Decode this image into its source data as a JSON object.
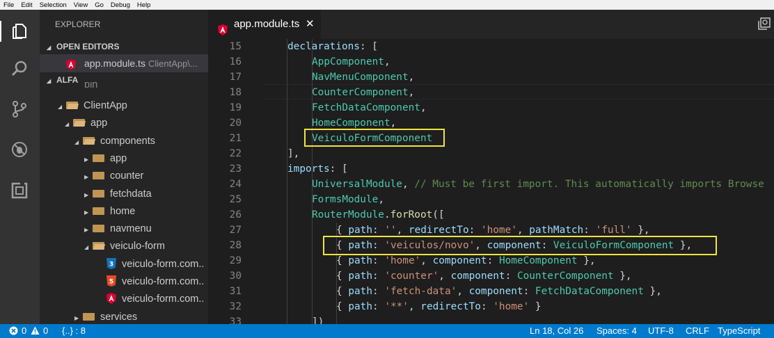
{
  "menubar": {
    "items": [
      "File",
      "Edit",
      "Selection",
      "View",
      "Go",
      "Debug",
      "Help"
    ]
  },
  "activity": {
    "icons": [
      "files-icon",
      "search-icon",
      "source-control-icon",
      "debug-icon",
      "extensions-icon"
    ]
  },
  "sidebar": {
    "title": "EXPLORER",
    "open_editors_label": "OPEN EDITORS",
    "open_editor": {
      "name": "app.module.ts",
      "path": "ClientApp\\..."
    },
    "project_label": "ALFA",
    "tree": [
      {
        "label": "bin"
      },
      {
        "label": "ClientApp"
      },
      {
        "label": "app"
      },
      {
        "label": "components"
      },
      {
        "label": "app"
      },
      {
        "label": "counter"
      },
      {
        "label": "fetchdata"
      },
      {
        "label": "home"
      },
      {
        "label": "navmenu"
      },
      {
        "label": "veiculo-form"
      },
      {
        "label": "veiculo-form.com..",
        "icon": "css-file-icon"
      },
      {
        "label": "veiculo-form.com..",
        "icon": "html-file-icon"
      },
      {
        "label": "veiculo-form.com..",
        "icon": "angular-file-icon"
      },
      {
        "label": "services"
      }
    ]
  },
  "tab": {
    "name": "app.module.ts",
    "close": "✕"
  },
  "editor": {
    "lines": [
      {
        "num": "15",
        "p1": "declarations",
        "p2": ": ["
      },
      {
        "num": "16",
        "p1": "AppComponent",
        "p2": ","
      },
      {
        "num": "17",
        "p1": "NavMenuComponent",
        "p2": ","
      },
      {
        "num": "18",
        "p1": "CounterComponent",
        "p2": ","
      },
      {
        "num": "19",
        "p1": "FetchDataComponent",
        "p2": ","
      },
      {
        "num": "20",
        "p1": "HomeComponent",
        "p2": ","
      },
      {
        "num": "21",
        "p1": "VeiculoFormComponent",
        "p2": ""
      },
      {
        "num": "22",
        "p1": "],",
        "p2": ""
      },
      {
        "num": "23",
        "p1": "imports",
        "p2": ": ["
      },
      {
        "num": "24",
        "p1": "UniversalModule",
        "p2": ", ",
        "p3": "// Must be first import. This automatically imports Browse"
      },
      {
        "num": "25",
        "p1": "FormsModule",
        "p2": ","
      },
      {
        "num": "26",
        "p1": "RouterModule",
        "p2": ".",
        "p3": "forRoot",
        "p4": "(["
      },
      {
        "num": "27",
        "text": "{ path: '', redirectTo: 'home', pathMatch: 'full' },"
      },
      {
        "num": "28",
        "text": "{ path: 'veiculos/novo', component: VeiculoFormComponent },"
      },
      {
        "num": "29",
        "text": "{ path: 'home', component: HomeComponent },"
      },
      {
        "num": "30",
        "text": "{ path: 'counter', component: CounterComponent },"
      },
      {
        "num": "31",
        "text": "{ path: 'fetch-data', component: FetchDataComponent },"
      },
      {
        "num": "32",
        "text": "{ path: '**', redirectTo: 'home' }"
      },
      {
        "num": "33",
        "text": "])"
      }
    ]
  },
  "status": {
    "errors": "0",
    "warnings": "0",
    "braces": "{..} : 8",
    "position": "Ln 18, Col 26",
    "spaces": "Spaces: 4",
    "encoding": "UTF-8",
    "eol": "CRLF",
    "language": "TypeScript"
  },
  "colors": {
    "accent": "#007acc",
    "highlight_box": "#f0e442",
    "angular": "#dd0031"
  }
}
